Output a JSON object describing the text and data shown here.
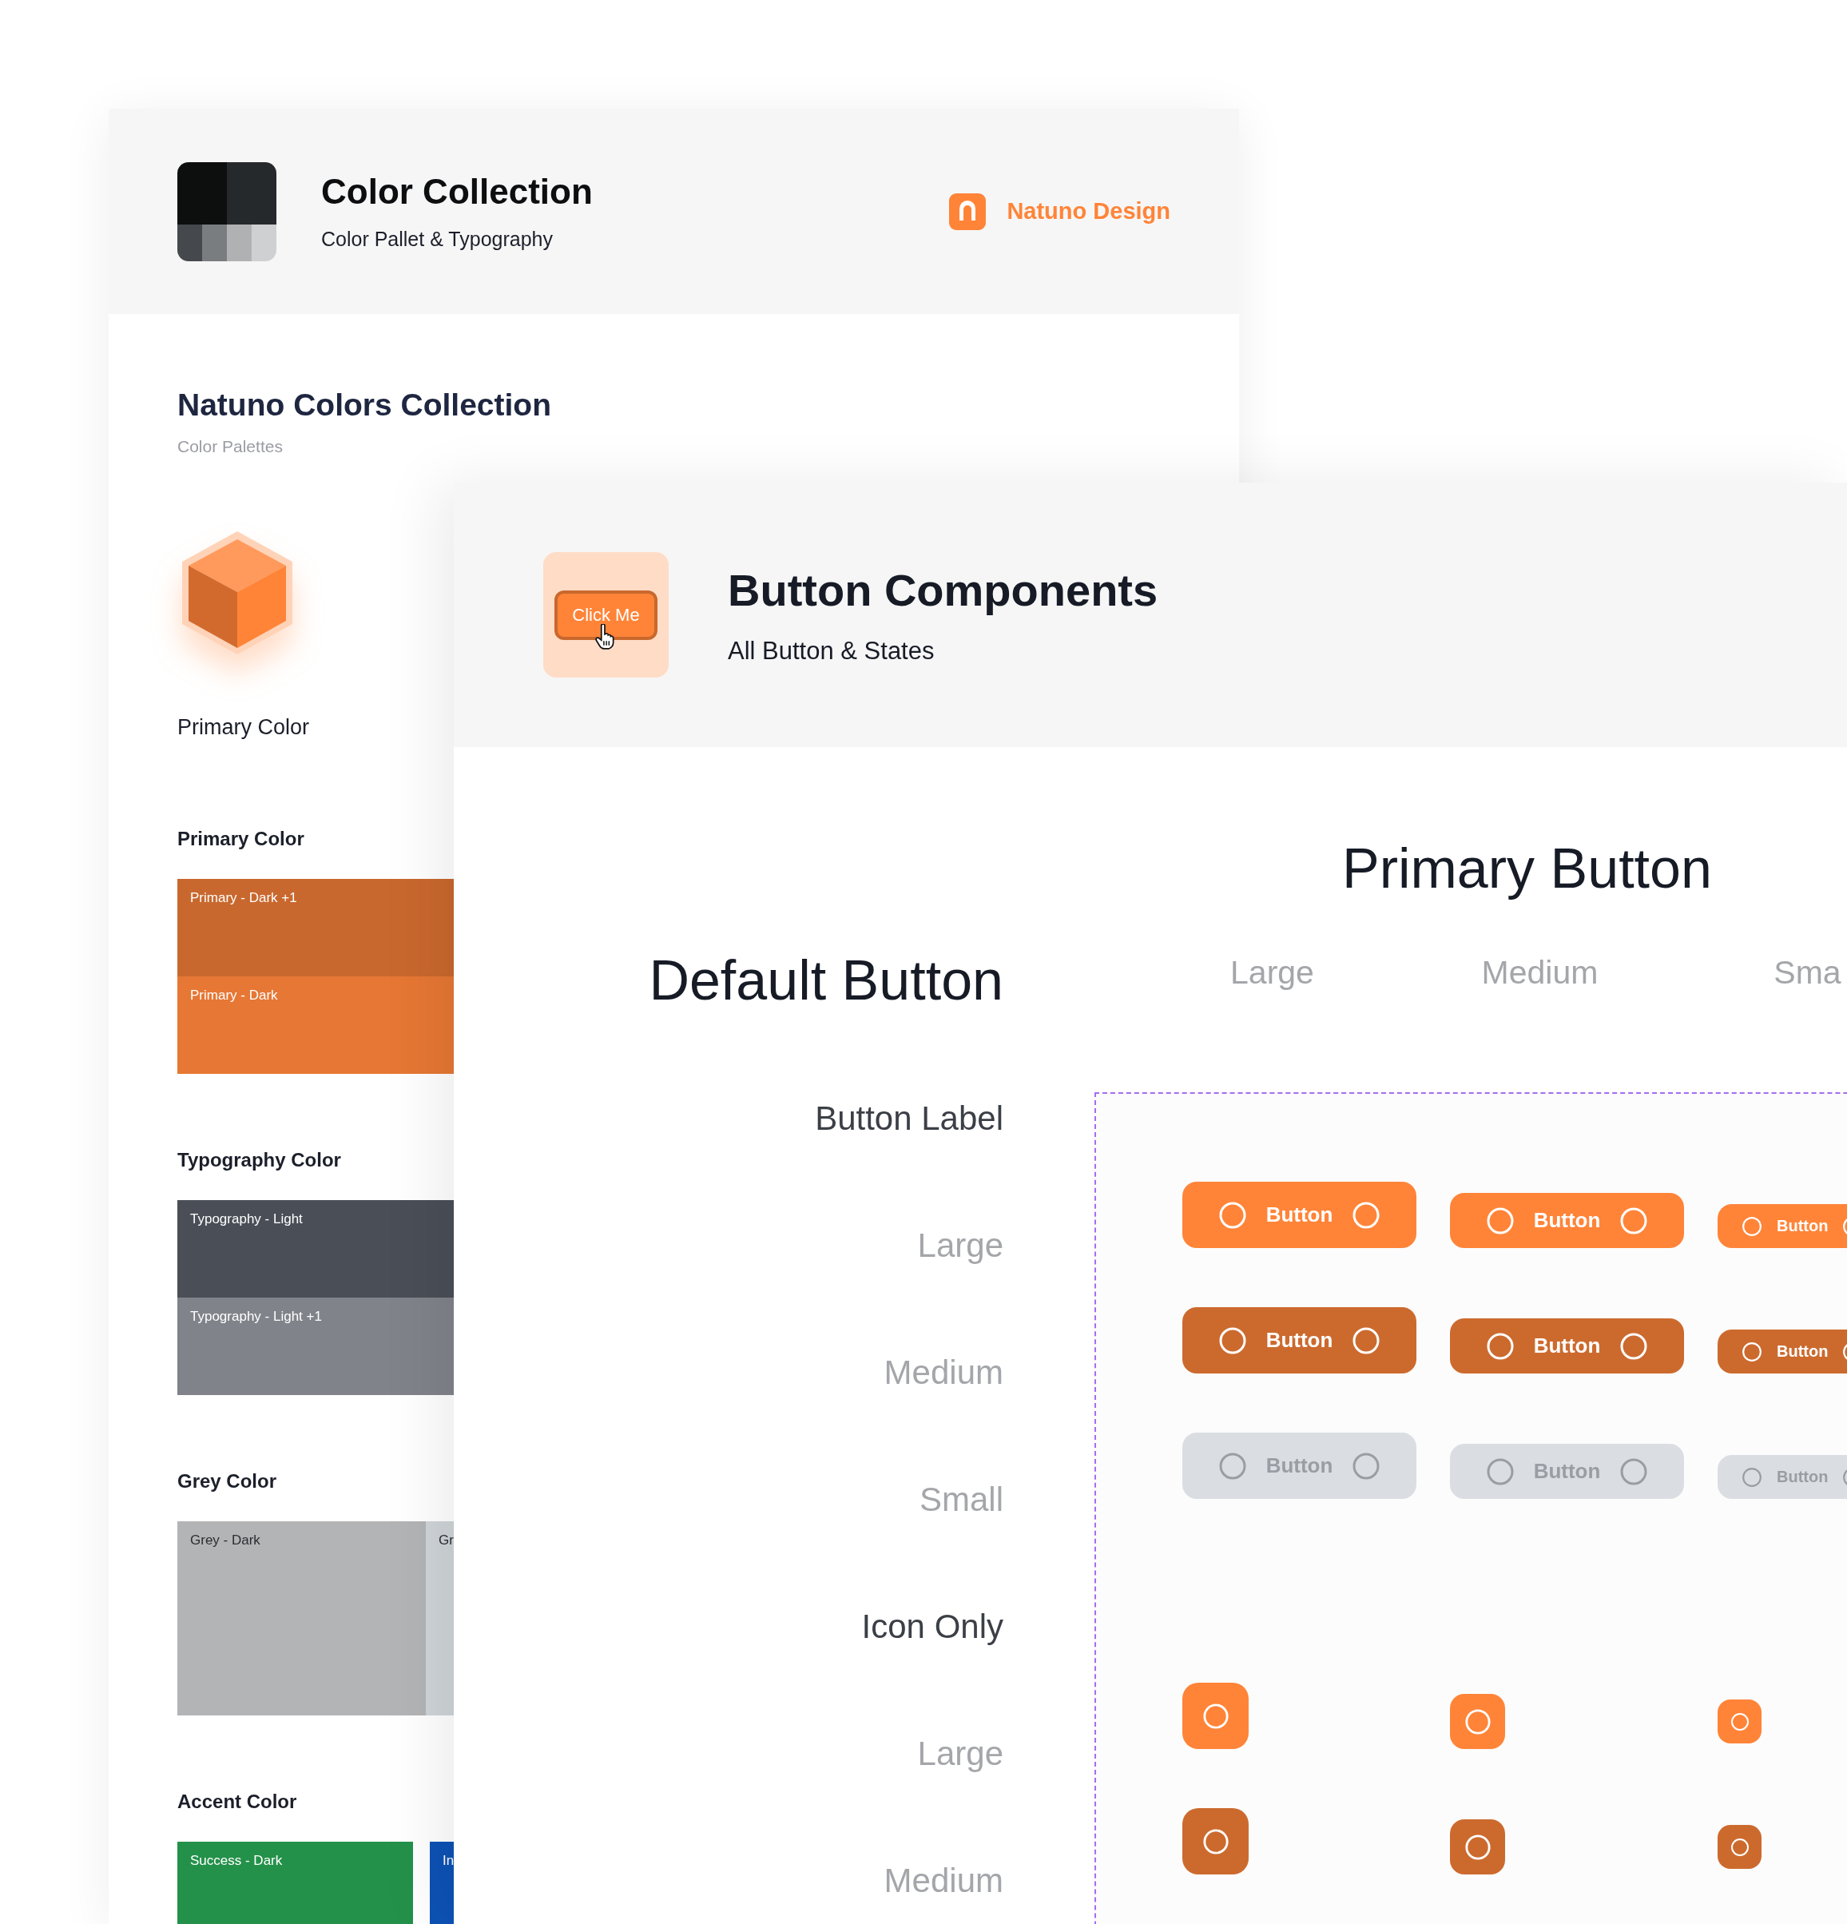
{
  "color_collection": {
    "title": "Color Collection",
    "subtitle": "Color Pallet & Typography",
    "brand": "Natuno Design",
    "section_title": "Natuno Colors Collection",
    "section_subtitle": "Color Palettes",
    "hero_label": "Primary Color",
    "groups": [
      {
        "title": "Primary Color",
        "kind": "stack",
        "swatches": [
          {
            "name": "Primary - Dark +1",
            "color": "#c9682e"
          },
          {
            "name": "Primary - Dark",
            "color": "#e67734"
          }
        ]
      },
      {
        "title": "Typography Color",
        "kind": "stack",
        "swatches": [
          {
            "name": "Typography - Light",
            "color": "#4a4e57"
          },
          {
            "name": "Typography - Light +1",
            "color": "#80838a"
          }
        ]
      },
      {
        "title": "Grey Color",
        "kind": "strip",
        "swatches": [
          {
            "name": "Grey - Dark",
            "color": "#b3b4b5"
          },
          {
            "name": "Gr",
            "color": "#cfd4d8"
          }
        ]
      },
      {
        "title": "Accent Color",
        "kind": "tiles",
        "swatches": [
          {
            "name": "Success - Dark",
            "color": "#24914a"
          },
          {
            "name": "In",
            "color": "#0d52b5"
          }
        ]
      }
    ]
  },
  "button_components": {
    "title": "Button Components",
    "subtitle": "All Button & States",
    "icon_label": "Click Me",
    "primary_heading": "Primary Button",
    "default_heading": "Default Button",
    "sizes": [
      "Large",
      "Medium",
      "Sma"
    ],
    "row_labels": [
      {
        "text": "Button Label",
        "kind": "heading"
      },
      {
        "text": "Large",
        "kind": "size"
      },
      {
        "text": "Medium",
        "kind": "size"
      },
      {
        "text": "Small",
        "kind": "size"
      },
      {
        "text": "Icon Only",
        "kind": "heading"
      },
      {
        "text": "Large",
        "kind": "size"
      },
      {
        "text": "Medium",
        "kind": "size"
      }
    ],
    "button_rows": [
      {
        "pressed": false,
        "disabled": false,
        "labels": [
          "Button",
          "Button",
          "Button"
        ]
      },
      {
        "pressed": true,
        "disabled": false,
        "labels": [
          "Button",
          "Button",
          "Button"
        ]
      },
      {
        "disabled": true,
        "labels": [
          "Button",
          "Button",
          "Button"
        ]
      }
    ],
    "icon_rows": [
      {
        "pressed": false
      },
      {
        "pressed": true
      }
    ]
  }
}
